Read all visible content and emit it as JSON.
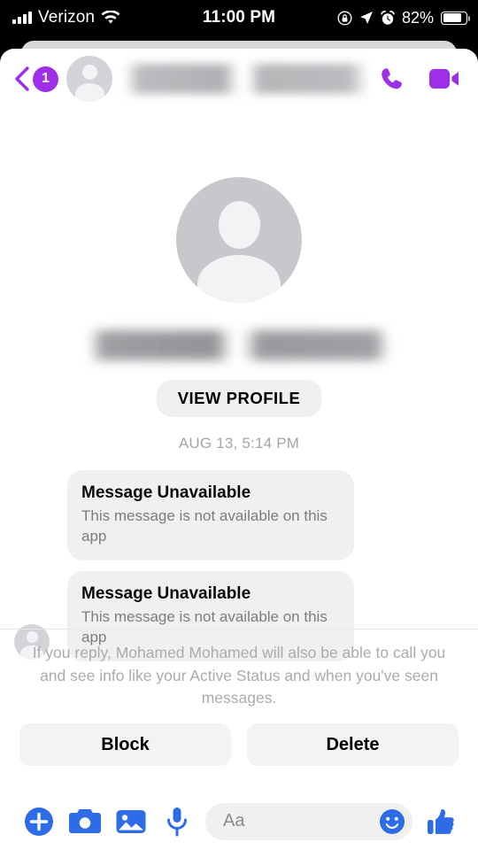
{
  "status_bar": {
    "carrier": "Verizon",
    "signal_icon": "signal-bars-icon",
    "wifi_icon": "wifi-icon",
    "time": "11:00 PM",
    "rotation_lock_icon": "rotation-lock-icon",
    "location_icon": "location-arrow-icon",
    "alarm_icon": "alarm-clock-icon",
    "battery_percent": "82%",
    "battery_icon": "battery-icon"
  },
  "header": {
    "back_icon": "back-chevron-icon",
    "unread_badge": "1",
    "avatar_icon": "contact-avatar-icon",
    "contact_name": "",
    "call_icon": "phone-call-icon",
    "video_icon": "video-camera-icon",
    "accent_color": "#9D2FE8"
  },
  "profile": {
    "avatar_icon": "default-profile-avatar-icon",
    "name": "",
    "view_profile_label": "VIEW PROFILE"
  },
  "thread": {
    "timestamp": "AUG 13, 5:14 PM",
    "messages": [
      {
        "title": "Message Unavailable",
        "subtitle": "This message is not available on this app",
        "show_avatar": false
      },
      {
        "title": "Message Unavailable",
        "subtitle": "This message is not available on this app",
        "show_avatar": true
      }
    ]
  },
  "footer": {
    "notice": "If you reply, Mohamed Mohamed will also be able to call you and see info like your Active Status and when you've seen messages.",
    "block_label": "Block",
    "delete_label": "Delete"
  },
  "composer": {
    "add_icon": "plus-circle-icon",
    "camera_icon": "camera-icon",
    "gallery_icon": "photo-gallery-icon",
    "mic_icon": "microphone-icon",
    "input_placeholder": "Aa",
    "emoji_icon": "smiley-face-icon",
    "like_icon": "thumbs-up-icon",
    "accent_color": "#2E6BE6"
  }
}
